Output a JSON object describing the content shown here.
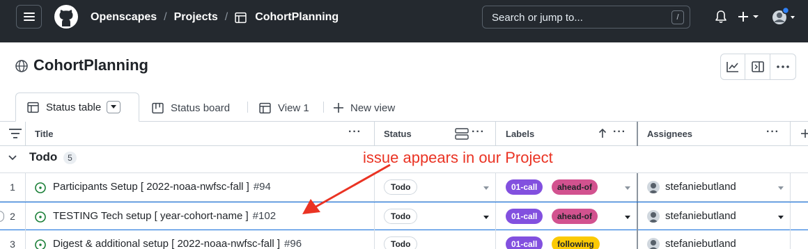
{
  "topbar": {
    "breadcrumbs": [
      "Openscapes",
      "Projects",
      "CohortPlanning"
    ],
    "search_placeholder": "Search or jump to...",
    "search_shortcut": "/"
  },
  "header": {
    "title": "CohortPlanning"
  },
  "tabs": [
    {
      "label": "Status table",
      "active": true
    },
    {
      "label": "Status board",
      "active": false
    },
    {
      "label": "View 1",
      "active": false
    },
    {
      "label": "New view",
      "active": false
    }
  ],
  "columns": {
    "title": "Title",
    "status": "Status",
    "labels": "Labels",
    "assignees": "Assignees"
  },
  "group": {
    "name": "Todo",
    "count": "5"
  },
  "rows": [
    {
      "num": "1",
      "title": "Participants Setup [ 2022-noaa-nwfsc-fall ]",
      "issue": "#94",
      "status": "Todo",
      "labels": [
        {
          "text": "01-call",
          "bg": "#8250df",
          "fg": "#ffffff"
        },
        {
          "text": "ahead-of",
          "bg": "#d2528f",
          "fg": "#1f2328"
        }
      ],
      "assignee": "stefaniebutland"
    },
    {
      "num": "2",
      "title": "TESTING Tech setup [ year-cohort-name ]",
      "issue": "#102",
      "status": "Todo",
      "labels": [
        {
          "text": "01-call",
          "bg": "#8250df",
          "fg": "#ffffff"
        },
        {
          "text": "ahead-of",
          "bg": "#d2528f",
          "fg": "#1f2328"
        }
      ],
      "assignee": "stefaniebutland"
    },
    {
      "num": "3",
      "title": "Digest & additional setup [ 2022-noaa-nwfsc-fall ]",
      "issue": "#96",
      "status": "Todo",
      "labels": [
        {
          "text": "01-call",
          "bg": "#8250df",
          "fg": "#ffffff"
        },
        {
          "text": "following",
          "bg": "#fbca04",
          "fg": "#1f2328"
        }
      ],
      "assignee": "stefaniebutland"
    }
  ],
  "annotation": {
    "text": "issue appears in our Project",
    "color": "#ea3323"
  }
}
